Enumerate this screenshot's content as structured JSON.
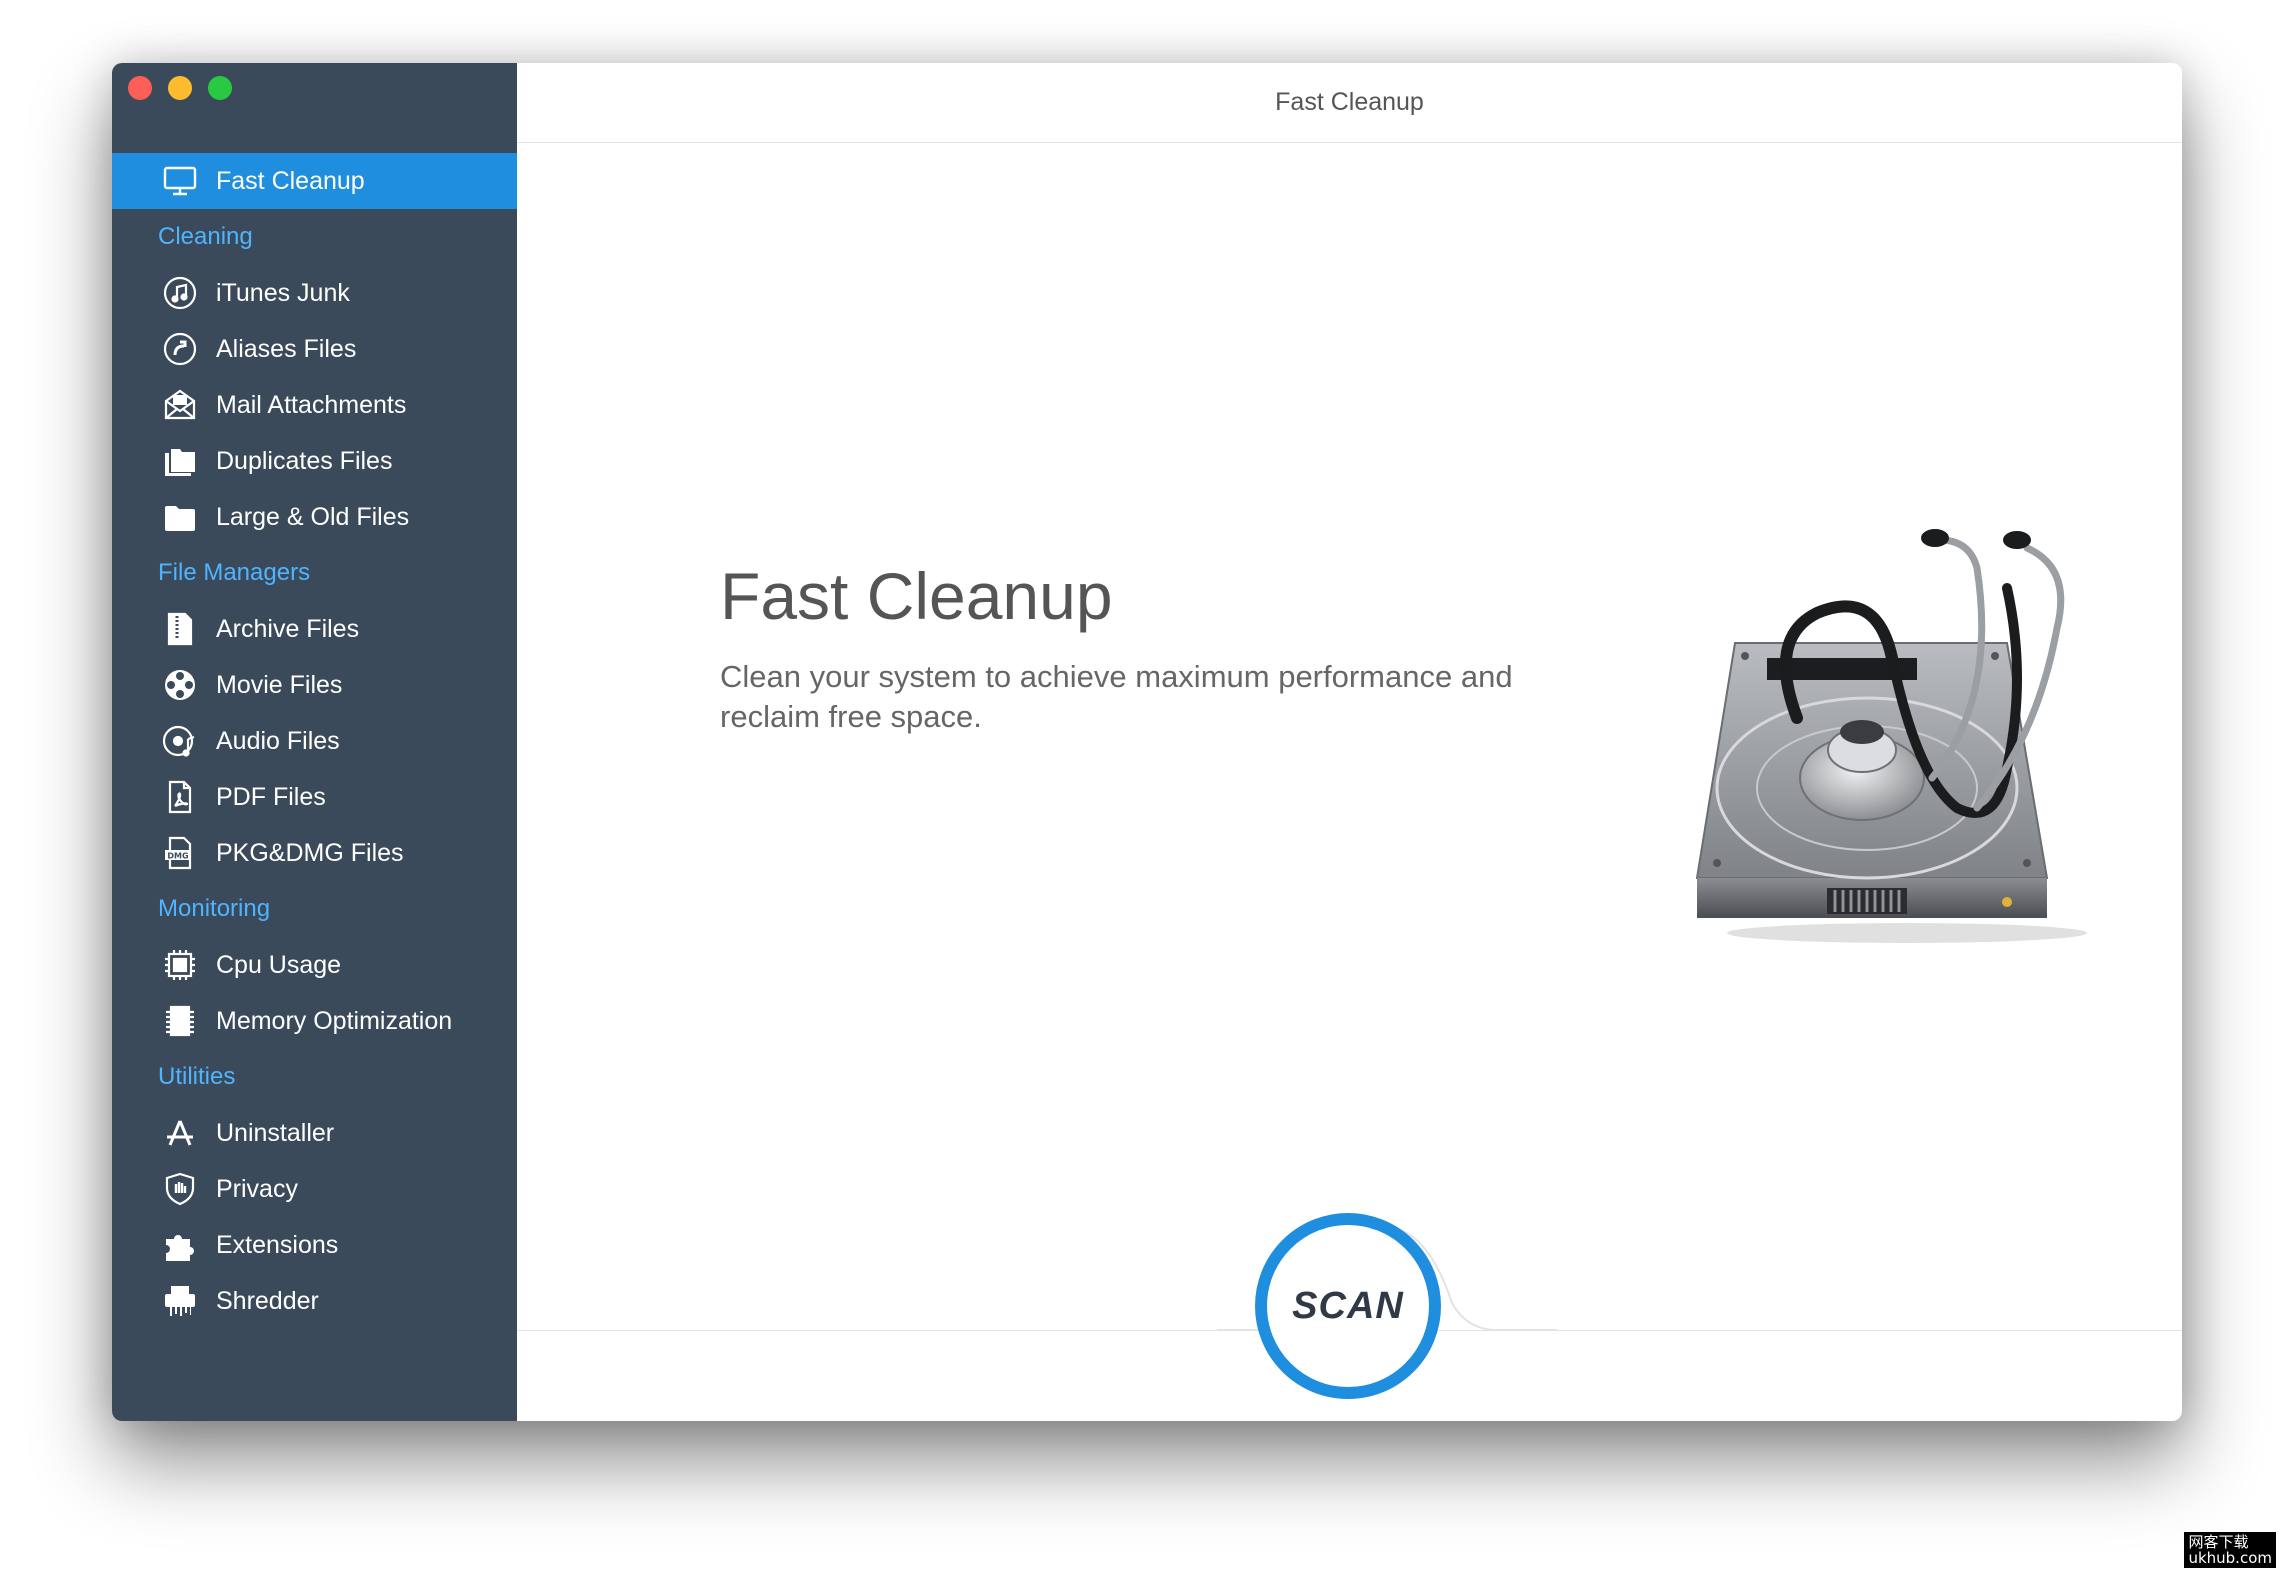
{
  "window": {
    "title": "Fast Cleanup"
  },
  "sidebar": {
    "top_item": {
      "label": "Fast Cleanup",
      "icon": "monitor-icon"
    },
    "sections": [
      {
        "label": "Cleaning",
        "items": [
          {
            "label": "iTunes Junk",
            "icon": "music-note-icon"
          },
          {
            "label": "Aliases Files",
            "icon": "alias-arrow-icon"
          },
          {
            "label": "Mail Attachments",
            "icon": "mail-envelope-icon"
          },
          {
            "label": "Duplicates Files",
            "icon": "duplicate-folders-icon"
          },
          {
            "label": "Large & Old Files",
            "icon": "folder-icon"
          }
        ]
      },
      {
        "label": "File Managers",
        "items": [
          {
            "label": "Archive Files",
            "icon": "archive-zip-icon"
          },
          {
            "label": "Movie Files",
            "icon": "film-reel-icon"
          },
          {
            "label": "Audio Files",
            "icon": "audio-disc-icon"
          },
          {
            "label": "PDF Files",
            "icon": "pdf-document-icon"
          },
          {
            "label": "PKG&DMG Files",
            "icon": "dmg-package-icon"
          }
        ]
      },
      {
        "label": "Monitoring",
        "items": [
          {
            "label": "Cpu Usage",
            "icon": "cpu-chip-icon"
          },
          {
            "label": "Memory Optimization",
            "icon": "memory-chip-icon"
          }
        ]
      },
      {
        "label": "Utilities",
        "items": [
          {
            "label": "Uninstaller",
            "icon": "app-store-icon"
          },
          {
            "label": "Privacy",
            "icon": "shield-hand-icon"
          },
          {
            "label": "Extensions",
            "icon": "puzzle-piece-icon"
          },
          {
            "label": "Shredder",
            "icon": "shredder-icon"
          }
        ]
      }
    ]
  },
  "main": {
    "heading": "Fast Cleanup",
    "description": "Clean your system to achieve maximum performance and reclaim free space.",
    "scan_label": "SCAN"
  },
  "watermark": {
    "line1": "网客下载",
    "line2": "ukhub.com"
  },
  "colors": {
    "sidebar_bg": "#3b4a5a",
    "accent": "#1f8ede",
    "section_label": "#4fb4ff"
  }
}
